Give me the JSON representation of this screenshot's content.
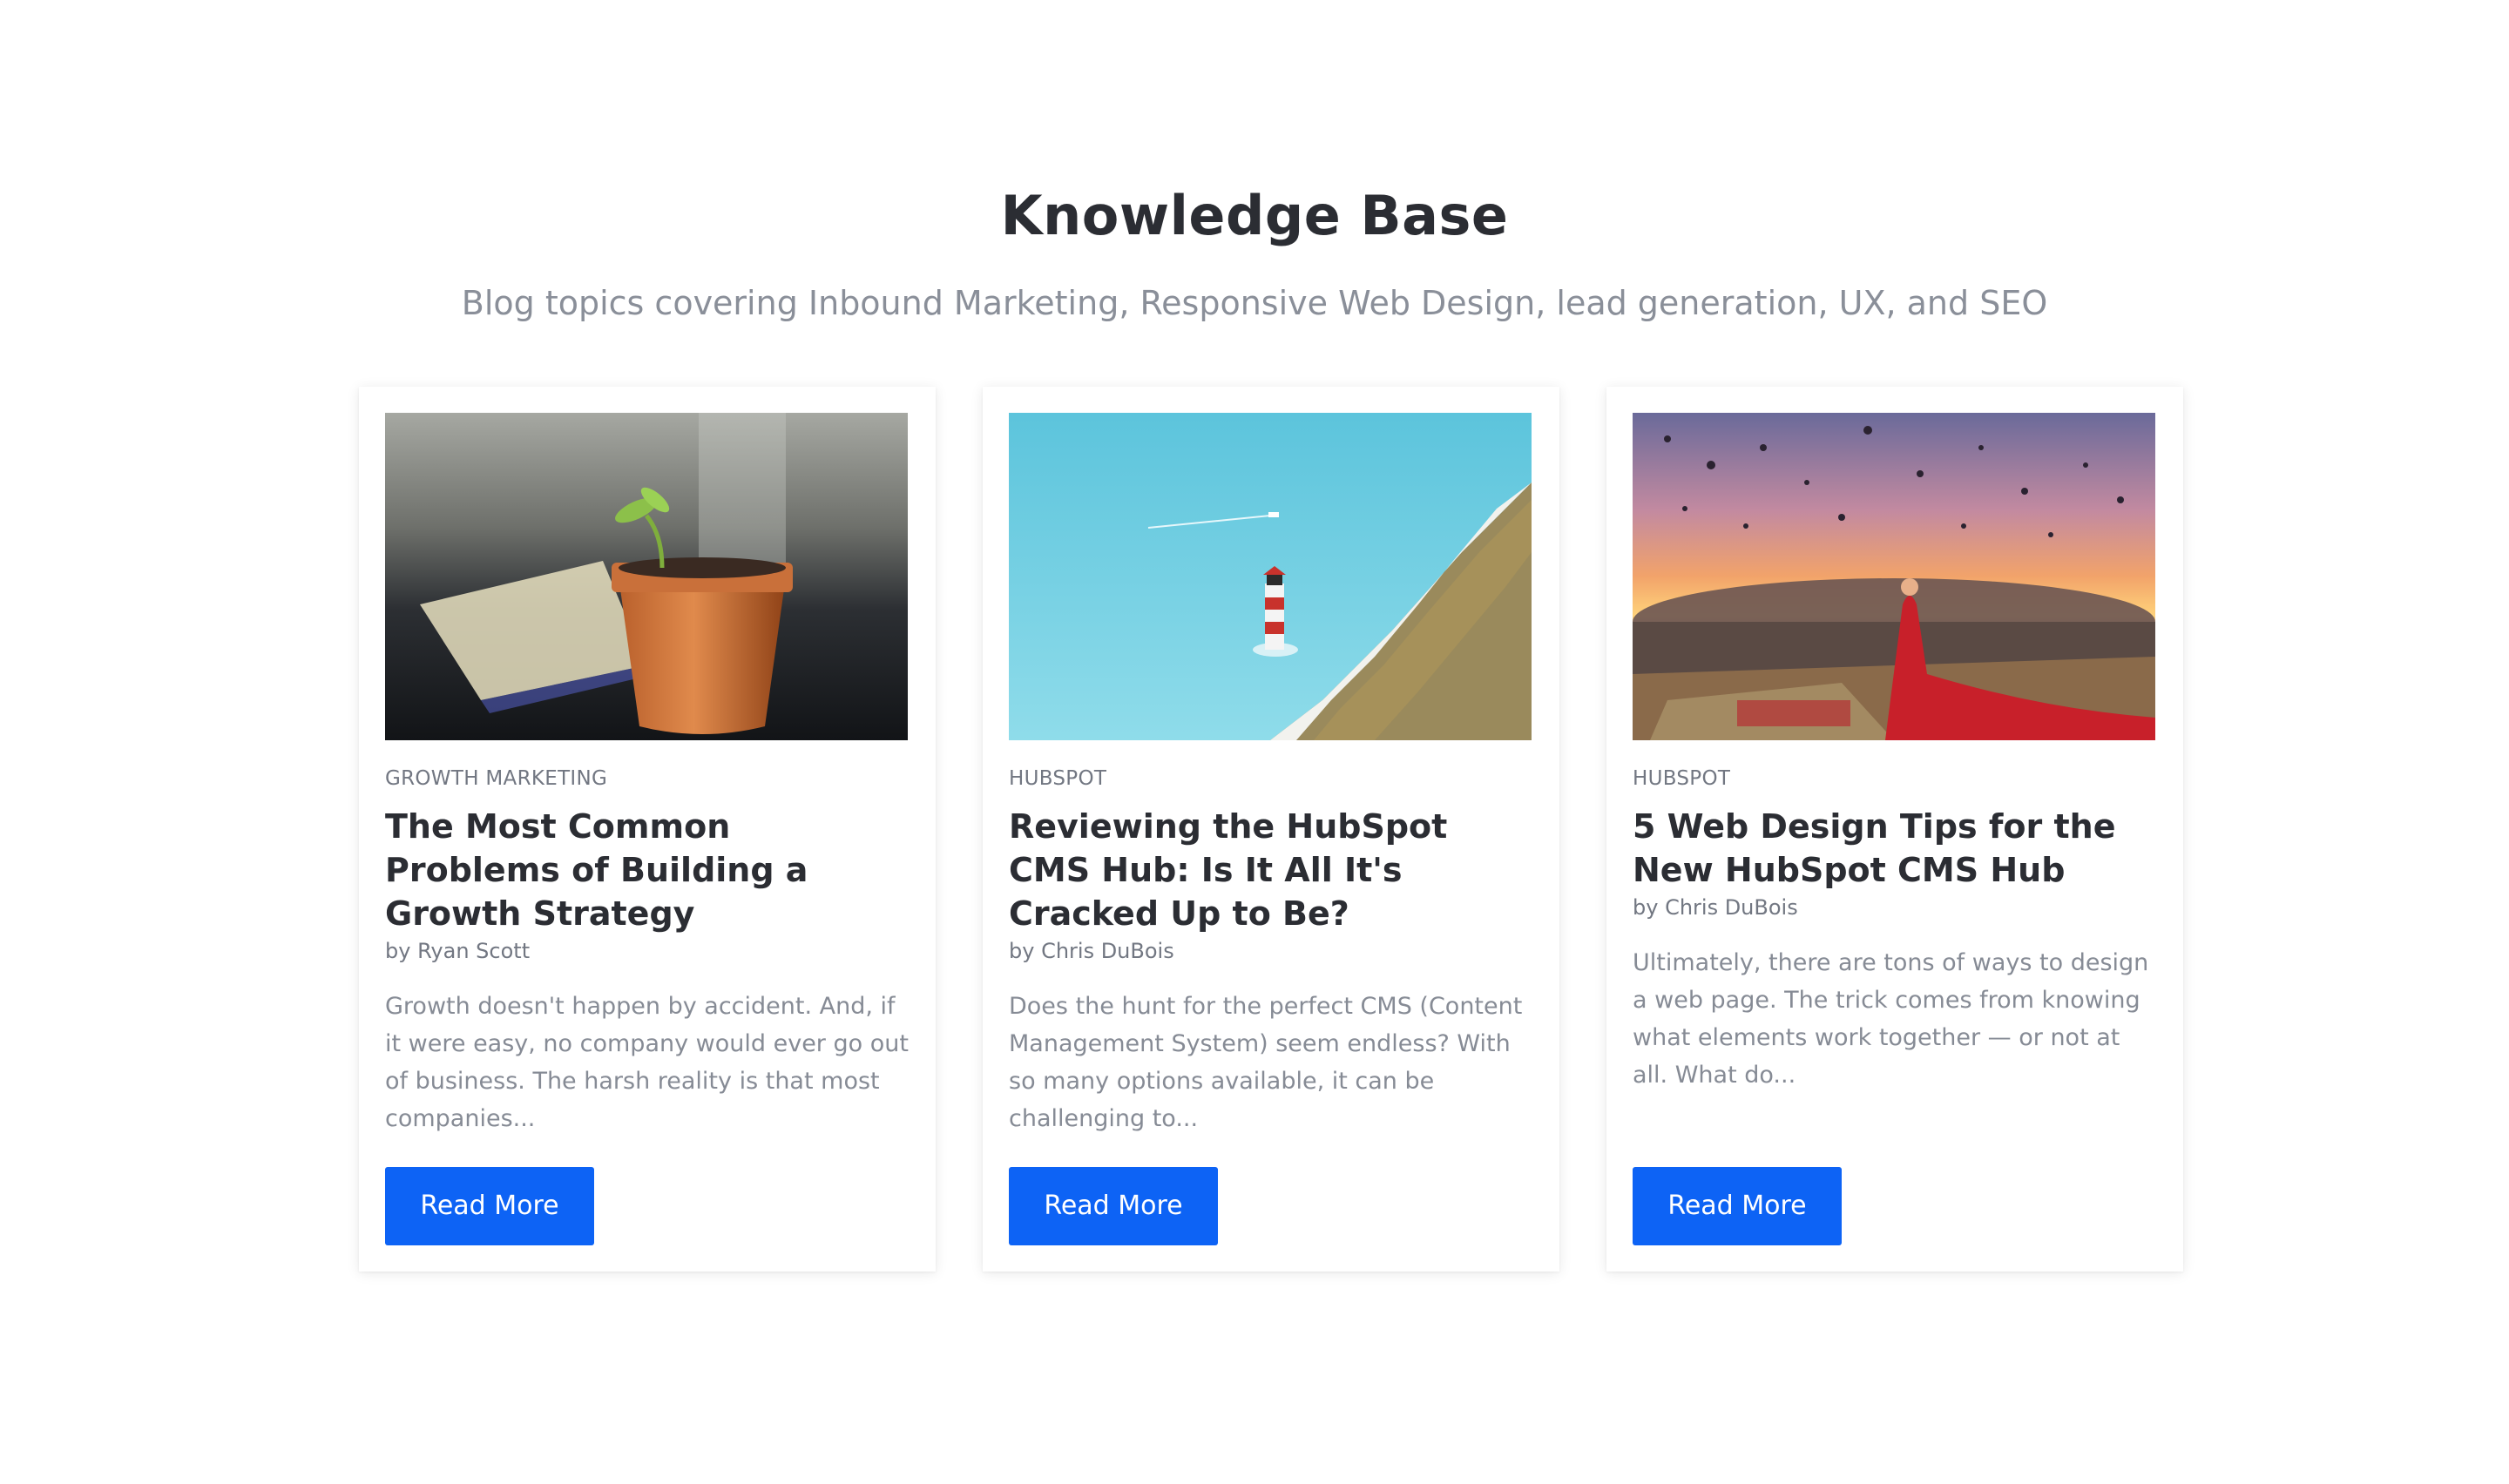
{
  "section": {
    "title": "Knowledge Base",
    "subtitle": "Blog topics covering Inbound Marketing, Responsive Web Design, lead generation, UX, and SEO"
  },
  "cards": [
    {
      "category": "GROWTH MARKETING",
      "title": "The Most Common Problems of Building a Growth Strategy",
      "author": "by Ryan Scott",
      "excerpt": "Growth doesn't happen by accident. And, if it were easy, no company would ever go out of business. The harsh reality is that most companies...",
      "button_label": "Read More",
      "image_subject": "potted-seedling"
    },
    {
      "category": "HUBSPOT",
      "title": "Reviewing the HubSpot CMS Hub: Is It All It's Cracked Up to Be?",
      "author": "by Chris DuBois",
      "excerpt": "Does the hunt for the perfect CMS (Content Management System) seem endless? With so many options available, it can be challenging to...",
      "button_label": "Read More",
      "image_subject": "lighthouse-sea-cliff"
    },
    {
      "category": "HUBSPOT",
      "title": "5 Web Design Tips for the New HubSpot CMS Hub",
      "author": "by Chris DuBois",
      "excerpt": "Ultimately, there are tons of ways to design a web page. The trick comes from knowing what elements work together — or not at all. What do...",
      "button_label": "Read More",
      "image_subject": "hot-air-balloons-sunset"
    }
  ],
  "colors": {
    "button": "#0d63f5",
    "heading": "#2b2d33",
    "muted": "#868b95"
  }
}
